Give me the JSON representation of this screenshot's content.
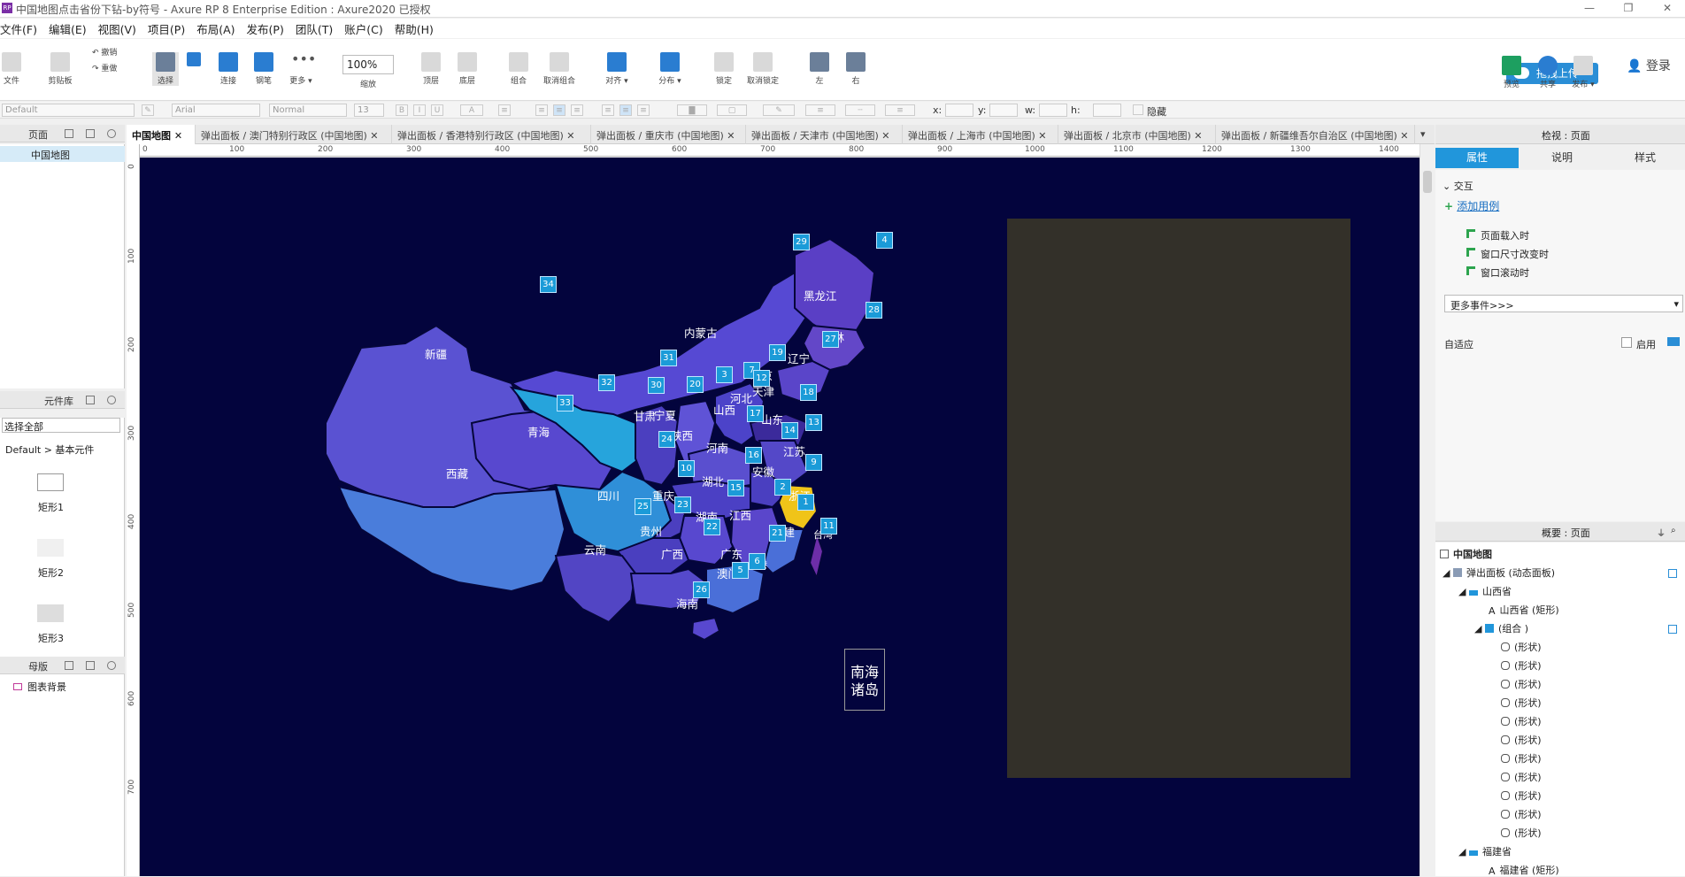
{
  "window": {
    "title": "中国地图点击省份下钻-by符号 - Axure RP 8 Enterprise Edition : Axure2020 已授权",
    "app_icon": "RP",
    "controls": [
      "—",
      "❐",
      "✕"
    ]
  },
  "menu": [
    "文件(F)",
    "编辑(E)",
    "视图(V)",
    "项目(P)",
    "布局(A)",
    "发布(P)",
    "团队(T)",
    "账户(C)",
    "帮助(H)"
  ],
  "toolbar": {
    "file": "文件",
    "clipboard": "剪贴板",
    "undo": "撤销",
    "redo": "重做",
    "select": "选择",
    "connect": "连接",
    "pen": "钢笔",
    "more": "更多 ▾",
    "zoom_value": "100%",
    "zoom_label": "缩放",
    "top": "顶层",
    "bottom": "底层",
    "group": "组合",
    "ungroup": "取消组合",
    "align": "对齐 ▾",
    "distribute": "分布 ▾",
    "lock": "锁定",
    "unlock": "取消锁定",
    "left": "左",
    "right": "右",
    "upload": "拖拽上传",
    "preview": "预览",
    "share": "共享",
    "publish": "发布 ▾",
    "login": "登录"
  },
  "format": {
    "style": "Default",
    "font": "Arial",
    "weight": "Normal",
    "size": "13",
    "x": "x:",
    "y": "y:",
    "w": "w:",
    "h": "h:",
    "hidden": "隐藏"
  },
  "pages_panel": {
    "title": "页面",
    "items": [
      "中国地图"
    ]
  },
  "library_panel": {
    "title": "元件库",
    "select": "选择全部",
    "group": "Default > 基本元件",
    "widgets": [
      "矩形1",
      "矩形2",
      "矩形3"
    ]
  },
  "master_panel": {
    "title": "母版",
    "items": [
      "图表背景"
    ]
  },
  "tabs": [
    "中国地图",
    "弹出面板 / 澳门特别行政区 (中国地图)",
    "弹出面板 / 香港特别行政区 (中国地图)",
    "弹出面板 / 重庆市 (中国地图)",
    "弹出面板 / 天津市 (中国地图)",
    "弹出面板 / 上海市 (中国地图)",
    "弹出面板 / 北京市 (中国地图)",
    "弹出面板 / 新疆维吾尔自治区 (中国地图)"
  ],
  "ruler": {
    "top": [
      "0",
      "100",
      "200",
      "300",
      "400",
      "500",
      "600",
      "700",
      "800",
      "900",
      "1000",
      "1100",
      "1200",
      "1300",
      "1400"
    ],
    "left": [
      "0",
      "100",
      "200",
      "300",
      "400",
      "500",
      "600",
      "700"
    ]
  },
  "map": {
    "provinces": [
      "黑龙江",
      "吉林",
      "辽宁",
      "内蒙古",
      "新疆",
      "北京",
      "天津",
      "河北",
      "山西",
      "宁夏",
      "青海",
      "山东",
      "陕西",
      "河南",
      "江苏",
      "西藏",
      "甘肃",
      "安徽",
      "湖北",
      "四川",
      "重庆",
      "浙江",
      "湖南",
      "江西",
      "贵州",
      "福建",
      "云南",
      "广西",
      "广东",
      "台湾",
      "香港",
      "澳门",
      "海南"
    ],
    "badges": [
      "29",
      "4",
      "34",
      "28",
      "27",
      "31",
      "19",
      "3",
      "7",
      "12",
      "32",
      "30",
      "20",
      "18",
      "33",
      "17",
      "24",
      "13",
      "14",
      "9",
      "10",
      "16",
      "2",
      "1",
      "15",
      "25",
      "23",
      "22",
      "21",
      "11",
      "6",
      "5",
      "26"
    ],
    "south_sea": "南海诸岛",
    "colors": {
      "canvas": "#03043d",
      "panel": "#333029",
      "highlight": "#f0c419",
      "badge": "#1b9bd8"
    }
  },
  "inspector": {
    "header": "检视 : 页面",
    "tabs": [
      "属性",
      "说明",
      "样式"
    ],
    "section": "交互",
    "add_case": "添加用例",
    "events": [
      "页面载入时",
      "窗口尺寸改变时",
      "窗口滚动时"
    ],
    "more_events": "更多事件>>>",
    "adaptive": "自适应",
    "enable": "启用"
  },
  "outline": {
    "header": "概要 : 页面",
    "root": "中国地图",
    "nodes": [
      "弹出面板 (动态面板)",
      "山西省",
      "山西省 (矩形)",
      "(组合 )",
      "(形状)",
      "(形状)",
      "(形状)",
      "(形状)",
      "(形状)",
      "(形状)",
      "(形状)",
      "(形状)",
      "(形状)",
      "(形状)",
      "(形状)",
      "福建省",
      "福建省 (矩形)"
    ]
  }
}
